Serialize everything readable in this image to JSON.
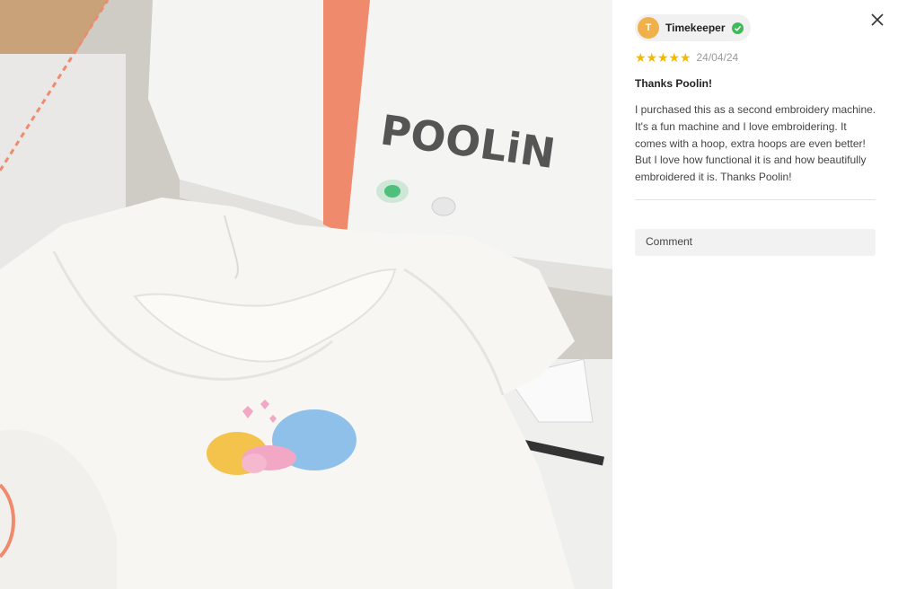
{
  "photo": {
    "brand_text": "POOLiN",
    "icon": "product-photo"
  },
  "review": {
    "close_icon": "close-icon",
    "user": {
      "avatar_initial": "T",
      "name": "Timekeeper",
      "verified_icon": "verified-check-icon"
    },
    "rating": 5,
    "rating_max": 5,
    "date": "24/04/24",
    "title": "Thanks Poolin!",
    "body": "I purchased this as a second embroidery machine. It's a fun machine and I love embroidering. It comes with a hoop, extra hoops are even better! But I love how functional it is and how beautifully embroidered it is. Thanks Poolin!",
    "comment_label": "Comment"
  },
  "colors": {
    "star": "#f5b800",
    "avatar": "#f1b14a",
    "verified": "#3fba57",
    "brand_accent": "#f08a6c"
  }
}
